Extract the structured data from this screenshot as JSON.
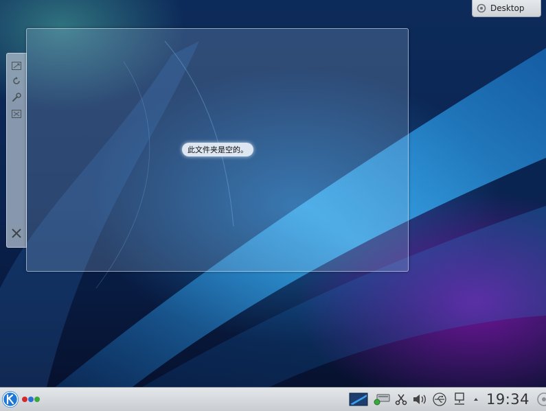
{
  "desktop": {
    "toolbox_label": "Desktop"
  },
  "folder_view": {
    "empty_message": "此文件夹是空的。"
  },
  "panel": {
    "pager_colors": [
      "#d22b2b",
      "#2b6fd2",
      "#3aa83a"
    ],
    "clock": "19:34"
  },
  "colors": {
    "accent": "#1d99f3",
    "panel_bg": "#d6dadd"
  }
}
